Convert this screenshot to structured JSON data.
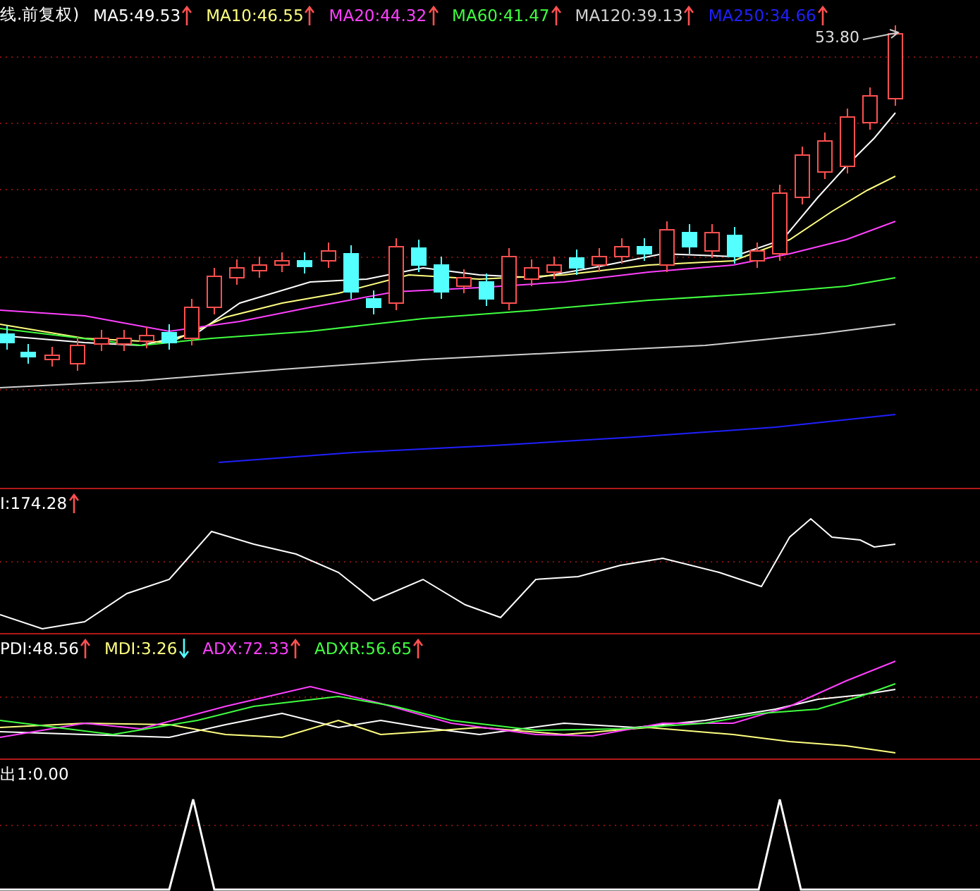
{
  "panels": [
    {
      "kind": "price",
      "title": "线.前复权)",
      "high_label": "53.80",
      "indicators": [
        {
          "label": "MA5:49.53",
          "color": "#ffffff",
          "rising": true
        },
        {
          "label": "MA10:46.55",
          "color": "#ffff80",
          "rising": true
        },
        {
          "label": "MA20:44.32",
          "color": "#ff40ff",
          "rising": true
        },
        {
          "label": "MA60:41.47",
          "color": "#40ff40",
          "rising": true
        },
        {
          "label": "MA120:39.13",
          "color": "#d0d0d0",
          "rising": true
        },
        {
          "label": "MA250:34.66",
          "color": "#2020ff",
          "rising": true
        }
      ]
    },
    {
      "kind": "oscillator",
      "indicators": [
        {
          "label": "I:174.28",
          "color": "#ffffff",
          "rising": true
        }
      ]
    },
    {
      "kind": "dmi",
      "indicators": [
        {
          "label": "PDI:48.56",
          "color": "#ffffff",
          "rising": true
        },
        {
          "label": "MDI:3.26",
          "color": "#ffff80",
          "rising": false
        },
        {
          "label": "ADX:72.33",
          "color": "#ff40ff",
          "rising": true
        },
        {
          "label": "ADXR:56.65",
          "color": "#40ff40",
          "rising": true
        }
      ]
    },
    {
      "kind": "signal",
      "indicators": [
        {
          "label": "出1:0.00",
          "color": "#ffffff"
        }
      ]
    }
  ]
}
